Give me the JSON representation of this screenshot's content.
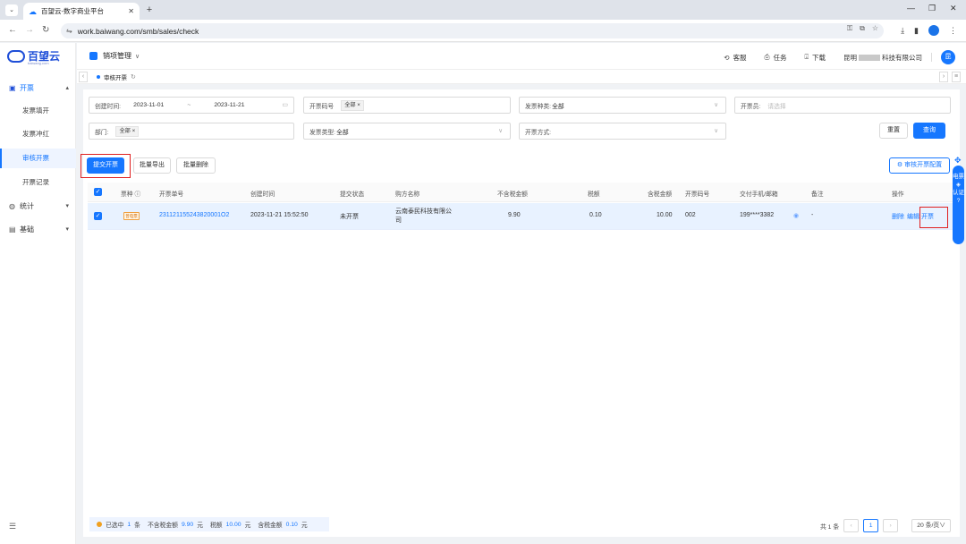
{
  "browser": {
    "tab_title": "百望云-数字商业平台",
    "url": "work.baiwang.com/smb/sales/check"
  },
  "sidebar": {
    "logo": "百望云",
    "logo_sub": "baiwang.com",
    "groups": [
      {
        "label": "开票",
        "icon": "invoice-icon",
        "open": true
      },
      {
        "label": "统计",
        "icon": "stats-icon",
        "open": false
      },
      {
        "label": "基础",
        "icon": "base-icon",
        "open": false
      }
    ],
    "items": [
      {
        "label": "发票填开"
      },
      {
        "label": "发票冲红"
      },
      {
        "label": "审核开票",
        "active": true
      },
      {
        "label": "开票记录"
      }
    ]
  },
  "header": {
    "module": "销项管理",
    "links": [
      "客服",
      "任务",
      "下载"
    ],
    "company_prefix": "昆明",
    "company_suffix": "科技有限公司",
    "avatar": "昆"
  },
  "tags": {
    "page_tag": "审核开票"
  },
  "filters": {
    "create_time_label": "创建时间:",
    "date_start": "2023-11-01",
    "date_sep": "~",
    "date_end": "2023-11-21",
    "code_label": "开票码号",
    "code_chip": "全部",
    "kind_label": "发票种类:",
    "kind_value": "全部",
    "issuer_label": "开票员:",
    "issuer_placeholder": "请选择",
    "dept_label": "部门:",
    "dept_chip": "全部",
    "type_label": "发票类型:",
    "type_value": "全部",
    "method_label": "开票方式:",
    "reset": "重置",
    "query": "查询"
  },
  "toolbar": {
    "submit": "提交开票",
    "export": "批量导出",
    "delete": "批量删除",
    "config": "审核开票配置"
  },
  "table": {
    "columns": [
      "票种",
      "开票单号",
      "创建时间",
      "提交状态",
      "购方名称",
      "不含税金额",
      "税额",
      "含税金额",
      "开票码号",
      "交付手机/邮箱",
      "备注",
      "操作"
    ],
    "rows": [
      {
        "type_tag": "普电票",
        "order_no": "231121155243820001O2",
        "created": "2023-11-21 15:52:50",
        "status": "未开票",
        "buyer_line1": "云南泰民科技有限公",
        "buyer_line2": "司",
        "amount_ex_tax": "9.90",
        "tax": "0.10",
        "amount_inc_tax": "10.00",
        "code": "002",
        "contact": "199****3382",
        "remark": "-",
        "actions": [
          "删除",
          "编辑",
          "开票"
        ]
      }
    ]
  },
  "summary": {
    "selected_label": "已选中",
    "selected_count": "1",
    "count_unit": "条",
    "ex_tax_label": "不含税金额",
    "ex_tax_value": "9.90",
    "tax_label": "税额",
    "tax_value": "10.00",
    "inc_tax_label": "含税金额",
    "inc_tax_value": "0.10",
    "currency": "元"
  },
  "pager": {
    "total": "共 1 条",
    "current": "1",
    "page_size": "20 条/页"
  },
  "float_widget": {
    "line1": "电票",
    "line2": "认证"
  }
}
